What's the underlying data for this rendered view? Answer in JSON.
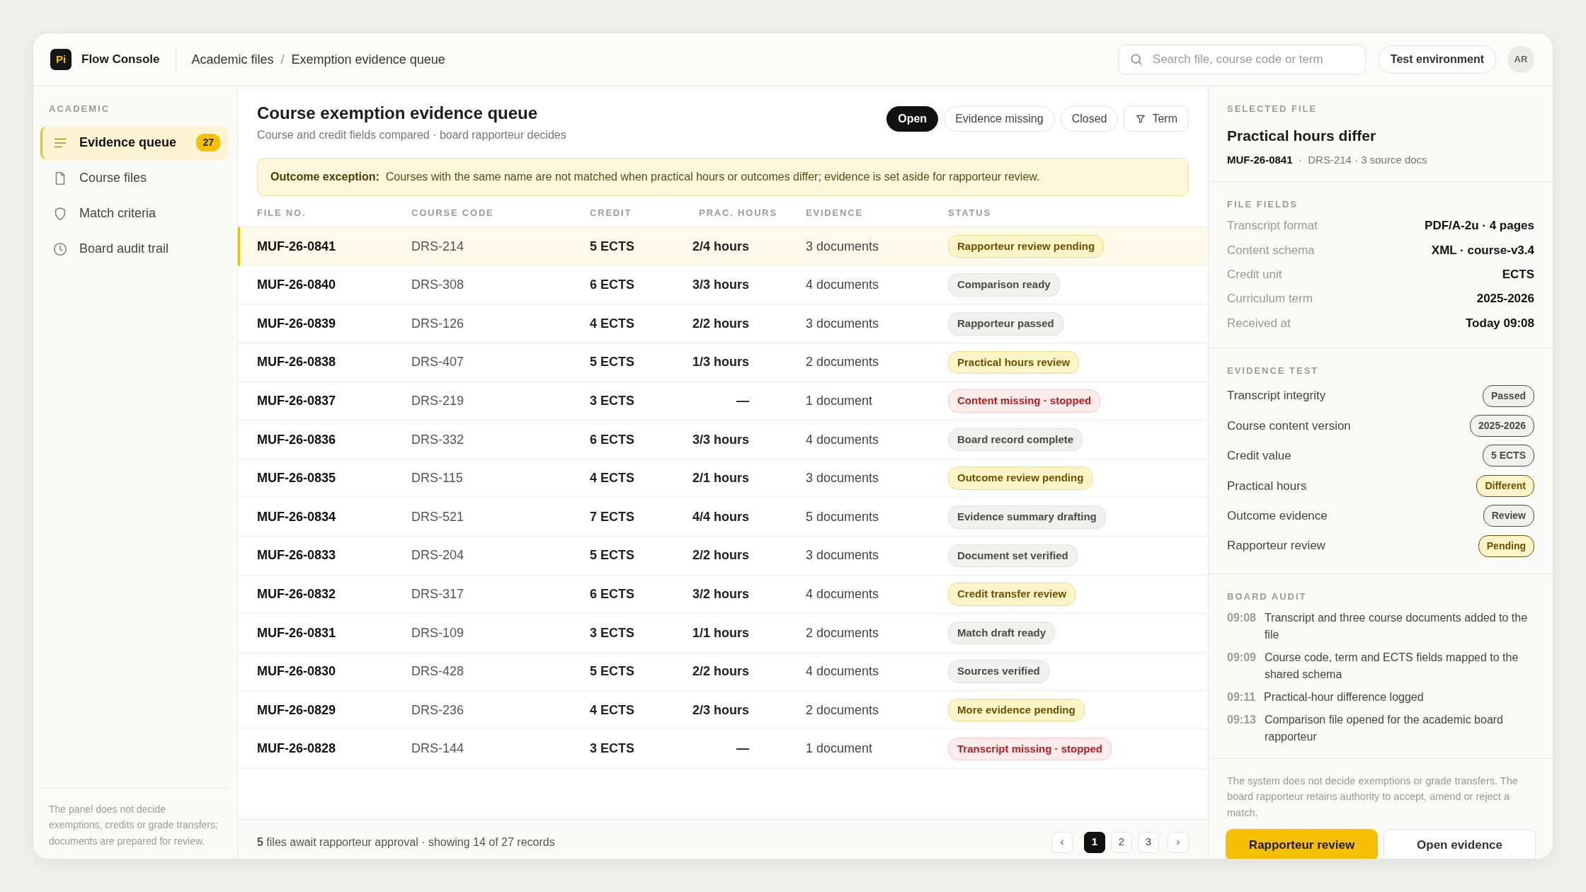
{
  "app": {
    "logo": "Pi",
    "name": "Flow Console"
  },
  "breadcrumb": [
    "Academic files",
    "/",
    "Exemption evidence queue"
  ],
  "search": {
    "placeholder": "Search file, course code or term"
  },
  "environment": "Test environment",
  "avatar": "AR",
  "sidebar": {
    "section": "ACADEMIC",
    "items": [
      {
        "label": "Evidence queue",
        "count": "27",
        "selected": true
      },
      {
        "label": "Course files",
        "selected": false
      },
      {
        "label": "Match criteria",
        "selected": false
      },
      {
        "label": "Board audit trail",
        "selected": false
      }
    ],
    "note": "The panel does not decide exemptions, credits or grade transfers; documents are prepared for review."
  },
  "main": {
    "title": "Course exemption evidence queue",
    "subtitle": "Course and credit fields compared · board rapporteur decides",
    "filters": [
      {
        "label": "Open",
        "selected": true
      },
      {
        "label": "Evidence missing",
        "selected": false
      },
      {
        "label": "Closed",
        "selected": false
      },
      {
        "label": "Term",
        "kind": "filter",
        "selected": false
      }
    ],
    "banner": "**Outcome exception:**  Courses with the same name are not matched when practical hours or outcomes differ; evidence is set aside for rapporteur review."
  },
  "table": {
    "columns": [
      "FILE NO.",
      "COURSE CODE",
      "CREDIT",
      "PRAC. HOURS",
      "EVIDENCE",
      "STATUS"
    ],
    "rows": [
      {
        "file": "MUF-26-0841",
        "course": "DRS-214",
        "credit": "5 ECTS",
        "hours": "2/4 hours",
        "evidence": "3 documents",
        "status": "Rapporteur review pending",
        "kind": "warn",
        "selected": true
      },
      {
        "file": "MUF-26-0840",
        "course": "DRS-308",
        "credit": "6 ECTS",
        "hours": "3/3 hours",
        "evidence": "4 documents",
        "status": "Comparison ready",
        "kind": "neutral",
        "selected": false
      },
      {
        "file": "MUF-26-0839",
        "course": "DRS-126",
        "credit": "4 ECTS",
        "hours": "2/2 hours",
        "evidence": "3 documents",
        "status": "Rapporteur passed",
        "kind": "neutral",
        "selected": false
      },
      {
        "file": "MUF-26-0838",
        "course": "DRS-407",
        "credit": "5 ECTS",
        "hours": "1/3 hours",
        "evidence": "2 documents",
        "status": "Practical hours review",
        "kind": "warn",
        "selected": false
      },
      {
        "file": "MUF-26-0837",
        "course": "DRS-219",
        "credit": "3 ECTS",
        "hours": "—",
        "evidence": "1 document",
        "status": "Content missing · stopped",
        "kind": "danger",
        "selected": false
      },
      {
        "file": "MUF-26-0836",
        "course": "DRS-332",
        "credit": "6 ECTS",
        "hours": "3/3 hours",
        "evidence": "4 documents",
        "status": "Board record complete",
        "kind": "neutral",
        "selected": false
      },
      {
        "file": "MUF-26-0835",
        "course": "DRS-115",
        "credit": "4 ECTS",
        "hours": "2/1 hours",
        "evidence": "3 documents",
        "status": "Outcome review pending",
        "kind": "warn",
        "selected": false
      },
      {
        "file": "MUF-26-0834",
        "course": "DRS-521",
        "credit": "7 ECTS",
        "hours": "4/4 hours",
        "evidence": "5 documents",
        "status": "Evidence summary drafting",
        "kind": "neutral",
        "selected": false
      },
      {
        "file": "MUF-26-0833",
        "course": "DRS-204",
        "credit": "5 ECTS",
        "hours": "2/2 hours",
        "evidence": "3 documents",
        "status": "Document set verified",
        "kind": "neutral",
        "selected": false
      },
      {
        "file": "MUF-26-0832",
        "course": "DRS-317",
        "credit": "6 ECTS",
        "hours": "3/2 hours",
        "evidence": "4 documents",
        "status": "Credit transfer review",
        "kind": "warn",
        "selected": false
      },
      {
        "file": "MUF-26-0831",
        "course": "DRS-109",
        "credit": "3 ECTS",
        "hours": "1/1 hours",
        "evidence": "2 documents",
        "status": "Match draft ready",
        "kind": "neutral",
        "selected": false
      },
      {
        "file": "MUF-26-0830",
        "course": "DRS-428",
        "credit": "5 ECTS",
        "hours": "2/2 hours",
        "evidence": "4 documents",
        "status": "Sources verified",
        "kind": "neutral",
        "selected": false
      },
      {
        "file": "MUF-26-0829",
        "course": "DRS-236",
        "credit": "4 ECTS",
        "hours": "2/3 hours",
        "evidence": "2 documents",
        "status": "More evidence pending",
        "kind": "warn",
        "selected": false
      },
      {
        "file": "MUF-26-0828",
        "course": "DRS-144",
        "credit": "3 ECTS",
        "hours": "—",
        "evidence": "1 document",
        "status": "Transcript missing · stopped",
        "kind": "danger",
        "selected": false
      }
    ]
  },
  "footer": {
    "summary": "**5** files await rapporteur approval · showing 14 of 27 records",
    "pages": [
      {
        "label": "‹",
        "kind": "arrow",
        "selected": false
      },
      {
        "label": "1",
        "selected": true
      },
      {
        "label": "2",
        "selected": false
      },
      {
        "label": "3",
        "selected": false
      },
      {
        "label": "›",
        "kind": "arrow",
        "selected": false
      }
    ]
  },
  "detail": {
    "section": "SELECTED FILE",
    "title": "Practical hours differ",
    "meta": "**MUF-26-0841**  ·  DRS-214 · 3 source docs",
    "fields_title": "FILE FIELDS",
    "fields": [
      {
        "label": "Transcript format",
        "value": "PDF/A-2u · 4 pages"
      },
      {
        "label": "Content schema",
        "value": "XML · course-v3.4"
      },
      {
        "label": "Credit unit",
        "value": "ECTS"
      },
      {
        "label": "Curriculum term",
        "value": "2025-2026"
      },
      {
        "label": "Received at",
        "value": "Today 09:08"
      }
    ],
    "tests_title": "EVIDENCE TEST",
    "tests": [
      {
        "label": "Transcript integrity",
        "value": "Passed",
        "kind": "neutral"
      },
      {
        "label": "Course content version",
        "value": "2025-2026",
        "kind": "neutral"
      },
      {
        "label": "Credit value",
        "value": "5 ECTS",
        "kind": "neutral"
      },
      {
        "label": "Practical hours",
        "value": "Different",
        "kind": "warn"
      },
      {
        "label": "Outcome evidence",
        "value": "Review",
        "kind": "neutral"
      },
      {
        "label": "Rapporteur review",
        "value": "Pending",
        "kind": "warn"
      }
    ],
    "audit_title": "BOARD AUDIT",
    "audit": [
      {
        "time": "09:08",
        "text": "Transcript and three course documents added to the file"
      },
      {
        "time": "09:09",
        "text": "Course code, term and ECTS fields mapped to the shared schema"
      },
      {
        "time": "09:11",
        "text": "Practical-hour difference logged"
      },
      {
        "time": "09:13",
        "text": "Comparison file opened for the academic board rapporteur"
      }
    ],
    "note": "The system does not decide exemptions or grade transfers. The board rapporteur retains authority to accept, amend or reject a match.",
    "buttons": [
      {
        "label": "Rapporteur review",
        "kind": "primary"
      },
      {
        "label": "Open evidence",
        "kind": "secondary"
      }
    ]
  }
}
